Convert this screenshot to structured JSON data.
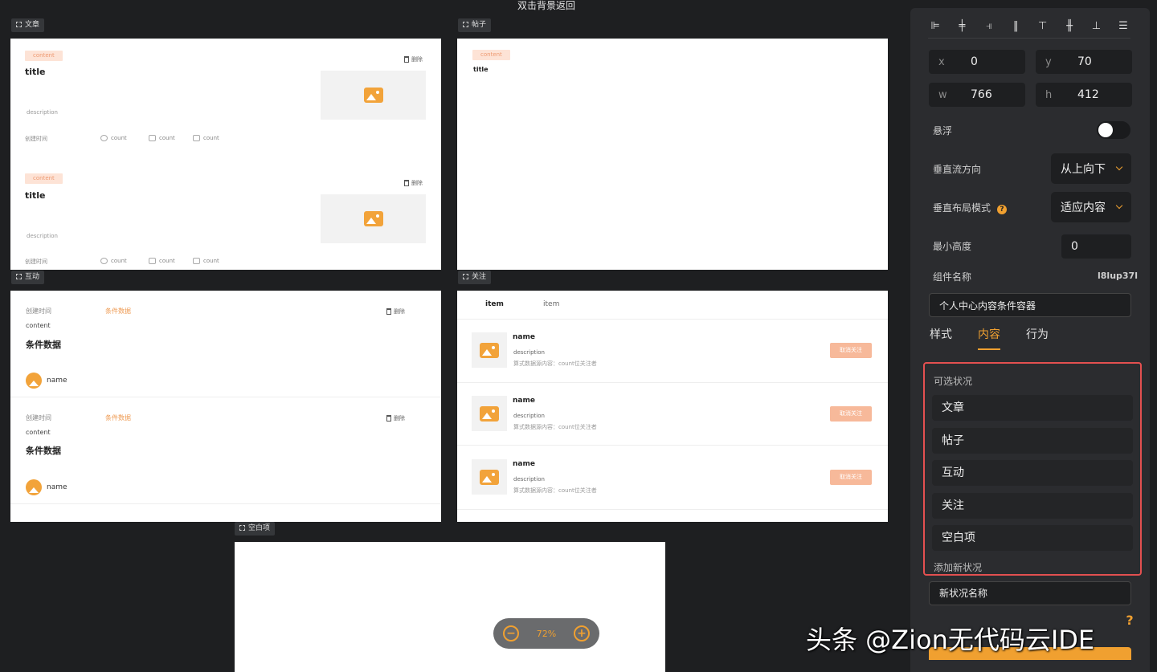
{
  "canvas": {
    "hint": "双击背景返回",
    "zoom_level": "72%",
    "tags": {
      "article": "文章",
      "post": "帖子",
      "interact": "互动",
      "follow": "关注",
      "empty": "空白项"
    },
    "article_card": {
      "pill": "content",
      "title": "title",
      "description": "description",
      "created": "创建时间",
      "count": "count",
      "delete": "删除"
    },
    "post_card": {
      "pill": "content",
      "title": "title"
    },
    "interact_card": {
      "created": "创建时间",
      "condition": "条件数据",
      "content": "content",
      "title": "条件数据",
      "name": "name",
      "delete": "删除"
    },
    "follow": {
      "tabs": [
        "item",
        "item"
      ],
      "rows": [
        {
          "name": "name",
          "description": "description",
          "sub": "算式数据源内容：count位关注者",
          "button": "取消关注"
        },
        {
          "name": "name",
          "description": "description",
          "sub": "算式数据源内容：count位关注者",
          "button": "取消关注"
        },
        {
          "name": "name",
          "description": "description",
          "sub": "算式数据源内容：count位关注者",
          "button": "取消关注"
        }
      ]
    }
  },
  "panel": {
    "x_label": "x",
    "x_value": "0",
    "y_label": "y",
    "y_value": "70",
    "w_label": "w",
    "w_value": "766",
    "h_label": "h",
    "h_value": "412",
    "float_label": "悬浮",
    "vflow_label": "垂直流方向",
    "vflow_value": "从上向下",
    "vlayout_label": "垂直布局模式",
    "vlayout_value": "适应内容",
    "minh_label": "最小高度",
    "minh_value": "0",
    "comp_label": "组件名称",
    "comp_id": "l8lup37l",
    "comp_name": "个人中心内容条件容器",
    "tabs": [
      "样式",
      "内容",
      "行为"
    ],
    "states_title": "可选状况",
    "states": [
      "文章",
      "帖子",
      "互动",
      "关注",
      "空白项"
    ],
    "add_state": "添加新状况",
    "new_state_placeholder": "新状况名称",
    "help": "?"
  },
  "watermark": "头条 @Zion无代码云IDE"
}
